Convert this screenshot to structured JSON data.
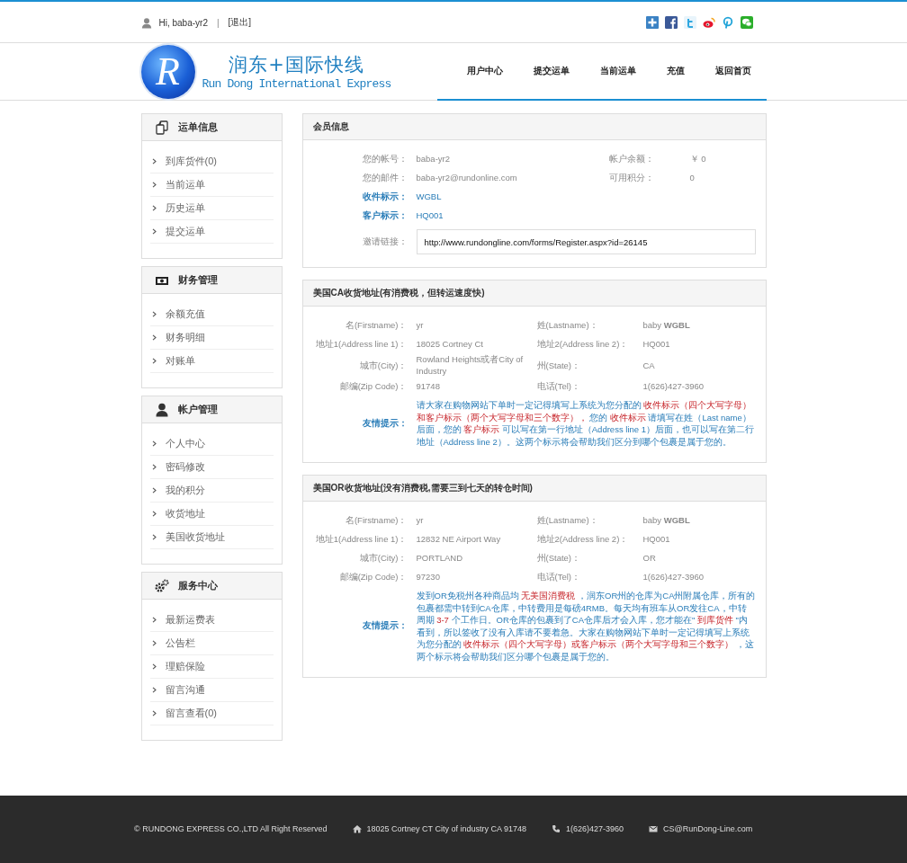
{
  "top_bar": {
    "greeting": "Hi, baba-yr2",
    "separator": "|",
    "logout": "[退出]"
  },
  "logo": {
    "mark": "R",
    "name_cn": "润东+国际快线",
    "name_en": "Run Dong International Express"
  },
  "nav": [
    {
      "label": "用户中心"
    },
    {
      "label": "提交运单"
    },
    {
      "label": "当前运单"
    },
    {
      "label": "充值"
    },
    {
      "label": "返回首页"
    }
  ],
  "sidebar": [
    {
      "kind": "docs",
      "title": "运单信息",
      "items": [
        "到库货件(0)",
        "当前运单",
        "历史运单",
        "提交运单"
      ]
    },
    {
      "kind": "money",
      "title": "财务管理",
      "items": [
        "余额充值",
        "财务明细",
        "对账单"
      ]
    },
    {
      "kind": "user",
      "title": "帐户管理",
      "items": [
        "个人中心",
        "密码修改",
        "我的积分",
        "收货地址",
        "美国收货地址"
      ]
    },
    {
      "kind": "gears",
      "title": "服务中心",
      "items": [
        "最新运费表",
        "公告栏",
        "理赔保险",
        "留言沟通",
        "留言查看(0)"
      ]
    }
  ],
  "member": {
    "title": "会员信息",
    "rows": [
      {
        "label": "您的帐号：",
        "value": "baba-yr2",
        "label2": "帐户余额：",
        "value2": "￥ 0",
        "emphasis": false
      },
      {
        "label": "您的邮件：",
        "value": "baba-yr2@rundonline.com",
        "label2": "可用积分：",
        "value2": "0",
        "emphasis": false
      },
      {
        "label": "收件标示：",
        "value": "WGBL",
        "emphasis": true
      },
      {
        "label": "客户标示：",
        "value": "HQ001",
        "emphasis": true
      }
    ],
    "invite": {
      "label": "邀请链接：",
      "value": "http://www.rundongline.com/forms/Register.aspx?id=26145"
    }
  },
  "addresses": [
    {
      "title": "美国CA收货地址(有消费税，但转运速度快)",
      "rows": [
        {
          "label": "名(Firstname)：",
          "value": "yr",
          "label2": "姓(Lastname)：",
          "value2": "baby **WGBL**"
        },
        {
          "label": "地址1(Address line 1)：",
          "value": "18025 Cortney Ct",
          "label2": "地址2(Address line 2)：",
          "value2": "HQ001"
        },
        {
          "label": "城市(City)：",
          "value": "Rowland Heights或者City of Industry",
          "label2": "州(State)：",
          "value2": "CA"
        },
        {
          "label": "邮编(Zip Code)：",
          "value": "91748",
          "label2": "电话(Tel)：",
          "value2": "1(626)427-3960"
        }
      ],
      "tip_label": "友情提示：",
      "tip": [
        {
          "kind": "plain",
          "text": "请大家在购物网站下单时一定记得填写上系统为您分配的 "
        },
        {
          "kind": "red",
          "text": "收件标示（四个大写字母）和客户标示（两个大写字母和三个数字），"
        },
        {
          "kind": "plain",
          "text": " 您的 "
        },
        {
          "kind": "red",
          "text": "收件标示"
        },
        {
          "kind": "plain",
          "text": " 请填写在姓（Last name）后面，您的 "
        },
        {
          "kind": "red",
          "text": "客户标示"
        },
        {
          "kind": "plain",
          "text": " 可以写在第一行地址（Address line 1）后面，也可以写在第二行地址（Address line 2）。这两个标示将会帮助我们区分到哪个包裹是属于您的。"
        }
      ]
    },
    {
      "title": "美国OR收货地址(没有消费税,需要三到七天的转仓时间)",
      "rows": [
        {
          "label": "名(Firstname)：",
          "value": "yr",
          "label2": "姓(Lastname)：",
          "value2": "baby **WGBL**"
        },
        {
          "label": "地址1(Address line 1)：",
          "value": "12832 NE Airport Way",
          "label2": "地址2(Address line 2)：",
          "value2": "HQ001"
        },
        {
          "label": "城市(City)：",
          "value": "PORTLAND",
          "label2": "州(State)：",
          "value2": "OR"
        },
        {
          "label": "邮编(Zip Code)：",
          "value": "97230",
          "label2": "电话(Tel)：",
          "value2": "1(626)427-3960"
        }
      ],
      "tip_label": "友情提示：",
      "tip": [
        {
          "kind": "plain",
          "text": "发到OR免税州各种商品均 "
        },
        {
          "kind": "red",
          "text": "无美国消费税"
        },
        {
          "kind": "plain",
          "text": " ，润东OR州的仓库为CA州附属仓库，所有的包裹都需中转到CA仓库，中转费用是每磅4RMB。每天均有班车从OR发往CA，中转周期 "
        },
        {
          "kind": "red",
          "text": "3-7"
        },
        {
          "kind": "plain",
          "text": " 个工作日。OR仓库的包裹到了CA仓库后才会入库，您才能在\" "
        },
        {
          "kind": "red",
          "text": "到库货件"
        },
        {
          "kind": "plain",
          "text": " \"内看到，所以签收了没有入库请不要着急。大家在购物网站下单时一定记得填写上系统为您分配的 "
        },
        {
          "kind": "red",
          "text": "收件标示（四个大写字母）或客户标示（两个大写字母和三个数字）"
        },
        {
          "kind": "plain",
          "text": " ，这两个标示将会帮助我们区分哪个包裹是属于您的。"
        }
      ]
    }
  ],
  "footer": {
    "copyright": "© RUNDONG EXPRESS CO.,LTD All Right Reserved",
    "address": "18025 Cortney CT City of industry CA 91748",
    "phone": "1(626)427-3960",
    "email": "CS@RunDong-Line.com"
  }
}
